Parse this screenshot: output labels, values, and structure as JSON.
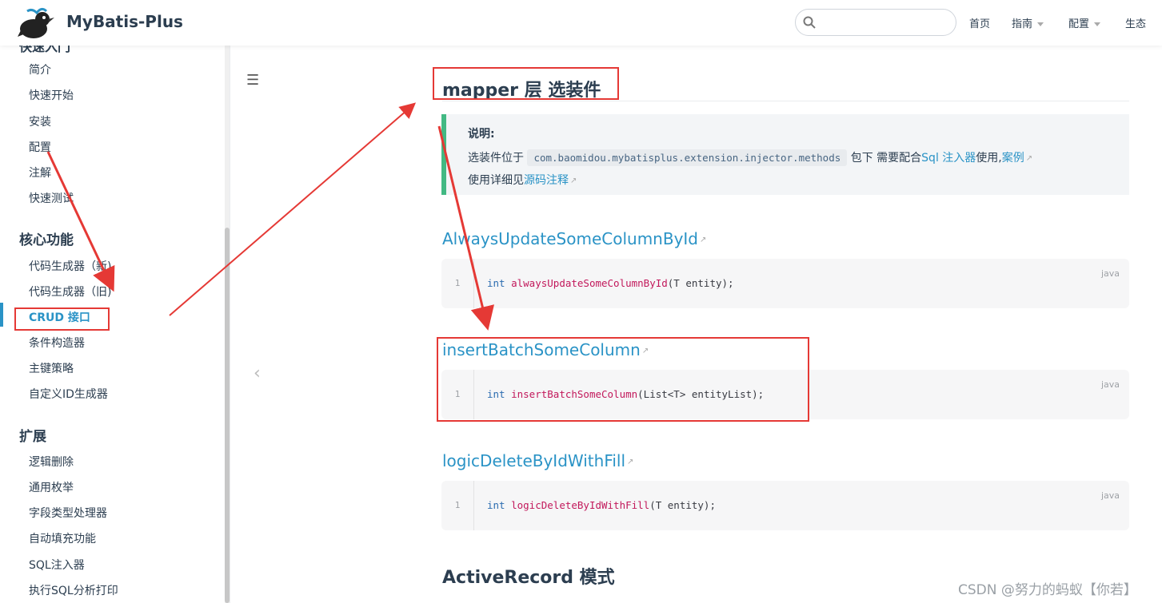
{
  "navbar": {
    "site_name": "MyBatis-Plus",
    "search_placeholder": "",
    "links": [
      {
        "label": "首页",
        "has_caret": false
      },
      {
        "label": "指南",
        "has_caret": true
      },
      {
        "label": "配置",
        "has_caret": true
      },
      {
        "label": "生态",
        "has_caret": false
      }
    ]
  },
  "sidebar": {
    "partial_heading": "快速入门",
    "group1_items": [
      "简介",
      "快速开始",
      "安装",
      "配置",
      "注解",
      "快速测试"
    ],
    "group2_title": "核心功能",
    "group2_items": [
      "代码生成器（新)",
      "代码生成器（旧)",
      "CRUD 接口",
      "条件构造器",
      "主键策略",
      "自定义ID生成器"
    ],
    "group3_title": "扩展",
    "group3_items": [
      "逻辑删除",
      "通用枚举",
      "字段类型处理器",
      "自动填充功能",
      "SQL注入器",
      "执行SQL分析打印"
    ],
    "active_item": "CRUD 接口"
  },
  "content": {
    "section_title": "mapper 层 选装件",
    "tip": {
      "title": "说明:",
      "line1_prefix": "选装件位于",
      "line1_code": "com.baomidou.mybatisplus.extension.injector.methods",
      "line1_mid": "包下 需要配合",
      "line1_link1": "Sql 注入器",
      "line1_mid2": "使用,",
      "line1_link2": "案例",
      "line2_prefix": "使用详细见",
      "line2_link": "源码注释"
    },
    "methods": [
      {
        "name": "AlwaysUpdateSomeColumnById",
        "code_kw": "int",
        "code_fn": "alwaysUpdateSomeColumnById",
        "code_args": "(T entity);",
        "lang": "java",
        "line": "1"
      },
      {
        "name": "insertBatchSomeColumn",
        "code_kw": "int",
        "code_fn": "insertBatchSomeColumn",
        "code_args": "(List<T> entityList);",
        "lang": "java",
        "line": "1"
      },
      {
        "name": "logicDeleteByIdWithFill",
        "code_kw": "int",
        "code_fn": "logicDeleteByIdWithFill",
        "code_args": "(T entity);",
        "lang": "java",
        "line": "1"
      }
    ],
    "next_section_title": "ActiveRecord 模式"
  },
  "watermark": "CSDN @努力的蚂蚁【你若】",
  "colors": {
    "accent": "#2a93c6",
    "tip_border": "#42b983",
    "annotation_red": "#e53935"
  }
}
